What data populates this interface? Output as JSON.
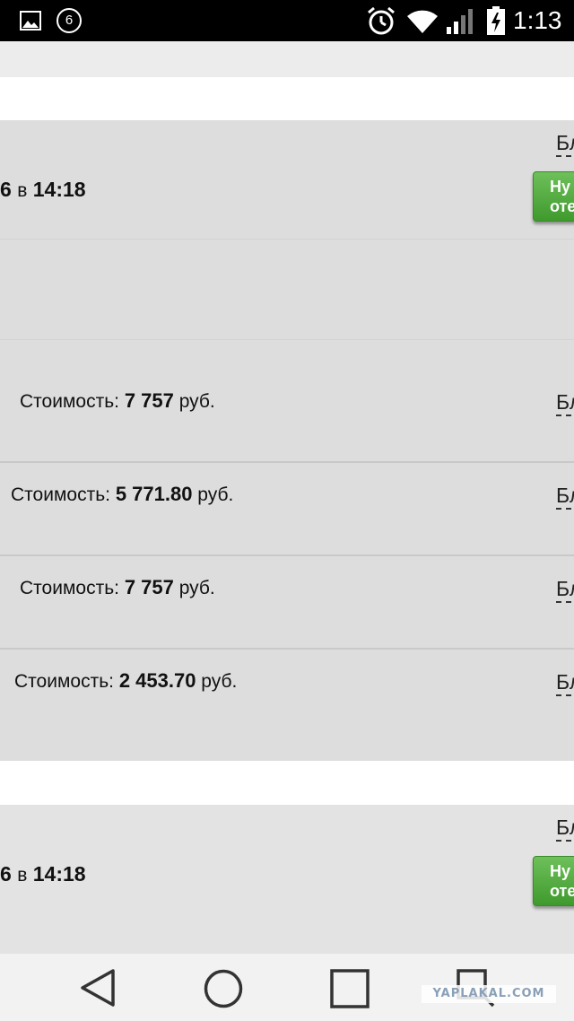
{
  "status_bar": {
    "notification_count": "6",
    "time": "1:13",
    "icons": [
      "gallery-icon",
      "alarm-icon",
      "wifi-icon",
      "signal-icon",
      "battery-icon"
    ]
  },
  "orders": [
    {
      "date_prefix": "6",
      "date_in": "в",
      "date_time": "14:18",
      "link_text": "Бл",
      "button_line1": "Ну",
      "button_line2": "оте",
      "items": [
        {
          "label": "Стоимость:",
          "amount": "7 757",
          "currency": "руб.",
          "link_text": "Бл"
        },
        {
          "label": "Стоимость:",
          "amount": "5 771.80",
          "currency": "руб.",
          "link_text": "Бл"
        },
        {
          "label": "Стоимость:",
          "amount": "7 757",
          "currency": "руб.",
          "link_text": "Бл"
        },
        {
          "label": "Стоимость:",
          "amount": "2 453.70",
          "currency": "руб.",
          "link_text": "Бл"
        }
      ]
    },
    {
      "date_prefix": "6",
      "date_in": "в",
      "date_time": "14:18",
      "link_text": "Бл",
      "button_line1": "Ну",
      "button_line2": "оте"
    }
  ],
  "watermark": "YAPLAKAL.COM",
  "colors": {
    "status_bar": "#000000",
    "card_bg": "#dddddd",
    "button_green": "#4caf3a",
    "nav_bar": "#f2f2f2"
  }
}
